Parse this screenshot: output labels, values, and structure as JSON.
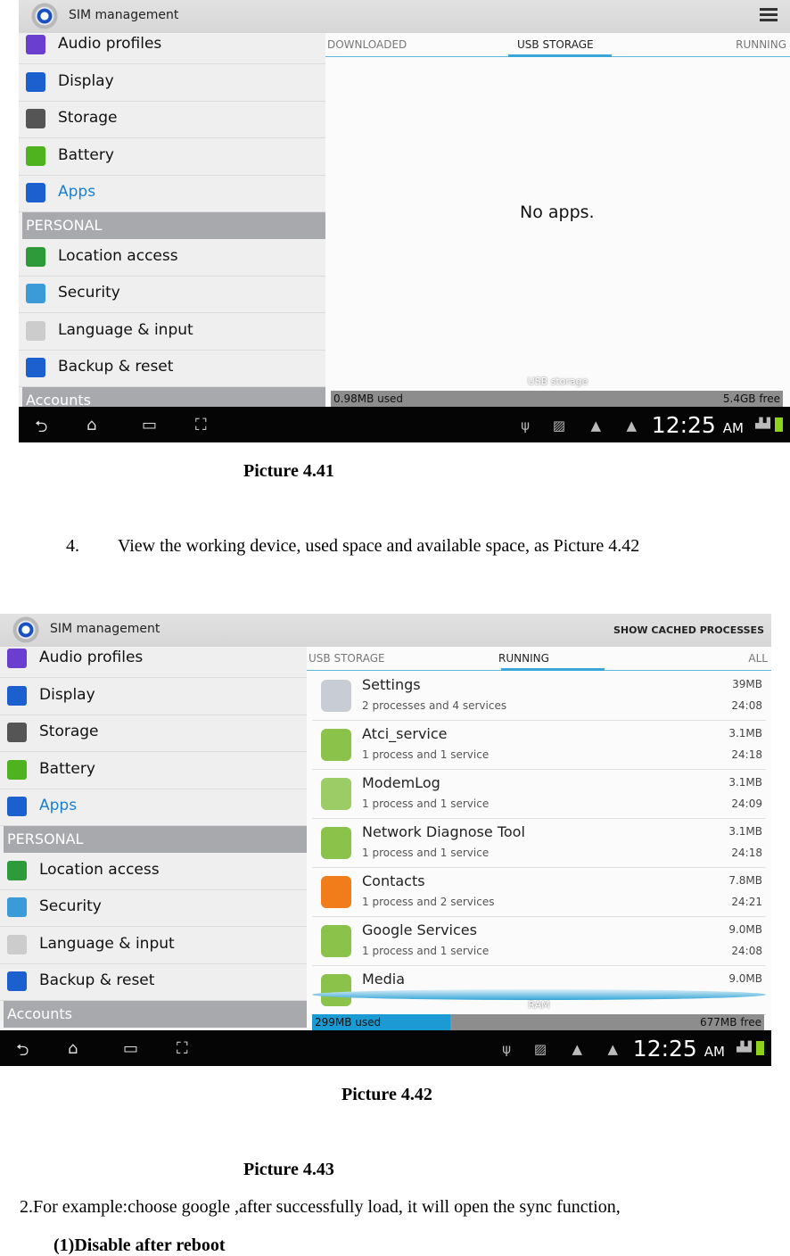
{
  "shot1": {
    "title": "SIM management",
    "menu": [
      {
        "label": "Audio profiles",
        "icon": "audio-icon",
        "color": "#6a3fd0"
      },
      {
        "label": "Display",
        "icon": "display-icon",
        "color": "#1c5fcf"
      },
      {
        "label": "Storage",
        "icon": "sd-card-icon",
        "color": "#555555"
      },
      {
        "label": "Battery",
        "icon": "battery-icon",
        "color": "#4fb31f"
      },
      {
        "label": "Apps",
        "icon": "apps-icon",
        "color": "#1c5fcf",
        "active": true
      }
    ],
    "section": "PERSONAL",
    "menu2": [
      {
        "label": "Location access",
        "icon": "location-icon",
        "color": "#2e9b3a"
      },
      {
        "label": "Security",
        "icon": "lock-icon",
        "color": "#3a9bd8"
      },
      {
        "label": "Language & input",
        "icon": "keyboard-icon",
        "color": "#cccccc"
      },
      {
        "label": "Backup & reset",
        "icon": "backup-icon",
        "color": "#1c5fcf"
      }
    ],
    "section2": "Accounts",
    "tabs": [
      "DOWNLOADED",
      "USB STORAGE",
      "RUNNING"
    ],
    "selected_tab": 1,
    "empty": "No apps.",
    "bar_label": "USB storage",
    "used": "0.98MB used",
    "free": "5.4GB free",
    "time": "12:25",
    "ampm": "AM"
  },
  "caption1": "Picture 4.41",
  "step_num": "4.",
  "step_text": "View the working device, used space and available space, as Picture 4.42",
  "shot2": {
    "title": "SIM management",
    "action": "SHOW CACHED PROCESSES",
    "tabs": [
      "USB STORAGE",
      "RUNNING",
      "ALL"
    ],
    "selected_tab": 1,
    "apps": [
      {
        "name": "Settings",
        "sub": "2 processes and 4 services",
        "mem": "39MB",
        "time": "24:08",
        "icon": "settings-gear-icon",
        "color": "#c8ccd4"
      },
      {
        "name": "Atci_service",
        "sub": "1 process and 1 service",
        "mem": "3.1MB",
        "time": "24:18",
        "icon": "android-icon",
        "color": "#8bc34a"
      },
      {
        "name": "ModemLog",
        "sub": "1 process and 1 service",
        "mem": "3.1MB",
        "time": "24:09",
        "icon": "modemlog-icon",
        "color": "#9ccc65"
      },
      {
        "name": "Network Diagnose Tool",
        "sub": "1 process and 1 service",
        "mem": "3.1MB",
        "time": "24:18",
        "icon": "android-icon",
        "color": "#8bc34a"
      },
      {
        "name": "Contacts",
        "sub": "1 process and 2 services",
        "mem": "7.8MB",
        "time": "24:21",
        "icon": "contacts-icon",
        "color": "#f07c1a"
      },
      {
        "name": "Google Services",
        "sub": "1 process and 1 service",
        "mem": "9.0MB",
        "time": "24:08",
        "icon": "android-icon",
        "color": "#8bc34a"
      },
      {
        "name": "Media",
        "sub": "",
        "mem": "9.0MB",
        "time": "",
        "icon": "android-icon",
        "color": "#8bc34a"
      }
    ],
    "bar_label": "RAM",
    "used": "299MB used",
    "free": "677MB free",
    "used_fraction": 0.306,
    "time": "12:25",
    "ampm": "AM"
  },
  "caption2": "Picture 4.42",
  "caption3": "Picture 4.43",
  "para": "2.For example:choose google ,after successfully load, it will open the sync function,",
  "para_bold_prefix": "2.",
  "sub_heading": "(1)Disable after reboot"
}
